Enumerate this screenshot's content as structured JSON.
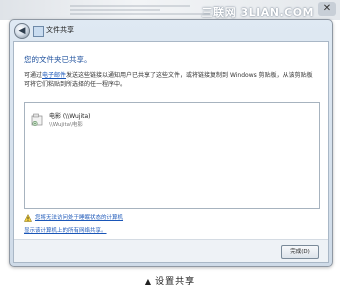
{
  "watermark": "三联网 3LIAN.COM",
  "window": {
    "title": "文件共享",
    "back_glyph": "◀",
    "close_glyph": "✕"
  },
  "content": {
    "heading": "您的文件夹已共享。",
    "desc_before_link": "可通过",
    "desc_link": "电子邮件",
    "desc_after_link": "发送这些链接以通知用户已共享了这些文件，或将链接复制到 Windows 剪贴板，从该剪贴板可将它们粘贴到所选择的任一程序中。",
    "share_items": [
      {
        "name": "电影 (\\\\Wujita)",
        "path": "\\\\Wujita\\电影"
      }
    ],
    "warning_link": "您将无法访问处于睡眠状态的计算机",
    "show_all_link": "显示该计算机上的所有网络共享。"
  },
  "footer": {
    "done_label": "完成(D)"
  },
  "caption": {
    "marker": "▲",
    "text": "设置共享"
  }
}
